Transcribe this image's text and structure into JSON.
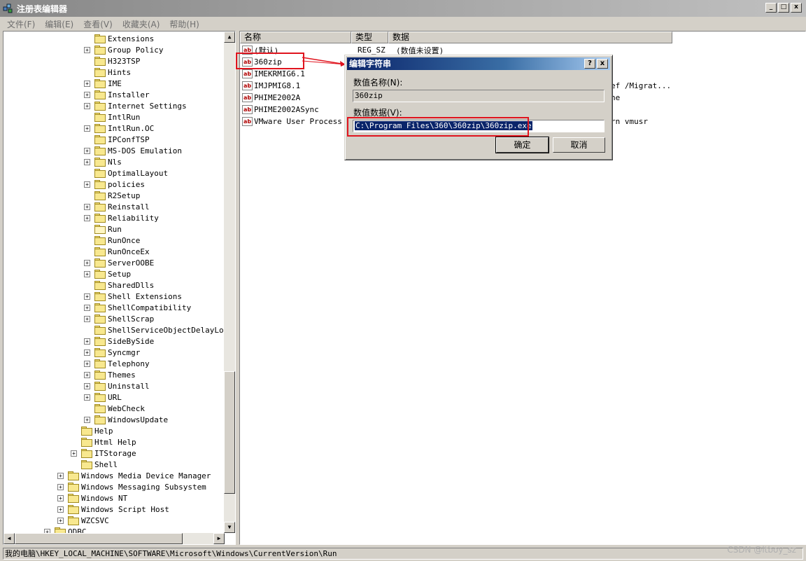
{
  "window": {
    "title": "注册表编辑器",
    "controls": [
      "_",
      "□",
      "x"
    ]
  },
  "menu": [
    "文件(F)",
    "编辑(E)",
    "查看(V)",
    "收藏夹(A)",
    "帮助(H)"
  ],
  "tree": {
    "items": [
      {
        "label": "Extensions",
        "level": 3,
        "expander": "none"
      },
      {
        "label": "Group Policy",
        "level": 3,
        "expander": "+"
      },
      {
        "label": "H323TSP",
        "level": 3,
        "expander": "none"
      },
      {
        "label": "Hints",
        "level": 3,
        "expander": "none"
      },
      {
        "label": "IME",
        "level": 3,
        "expander": "+"
      },
      {
        "label": "Installer",
        "level": 3,
        "expander": "+"
      },
      {
        "label": "Internet Settings",
        "level": 3,
        "expander": "+"
      },
      {
        "label": "IntlRun",
        "level": 3,
        "expander": "none"
      },
      {
        "label": "IntlRun.OC",
        "level": 3,
        "expander": "+"
      },
      {
        "label": "IPConfTSP",
        "level": 3,
        "expander": "none"
      },
      {
        "label": "MS-DOS Emulation",
        "level": 3,
        "expander": "+"
      },
      {
        "label": "Nls",
        "level": 3,
        "expander": "+"
      },
      {
        "label": "OptimalLayout",
        "level": 3,
        "expander": "none"
      },
      {
        "label": "policies",
        "level": 3,
        "expander": "+"
      },
      {
        "label": "R2Setup",
        "level": 3,
        "expander": "none"
      },
      {
        "label": "Reinstall",
        "level": 3,
        "expander": "+"
      },
      {
        "label": "Reliability",
        "level": 3,
        "expander": "+"
      },
      {
        "label": "Run",
        "level": 3,
        "expander": "none",
        "open": true
      },
      {
        "label": "RunOnce",
        "level": 3,
        "expander": "none"
      },
      {
        "label": "RunOnceEx",
        "level": 3,
        "expander": "none"
      },
      {
        "label": "ServerOOBE",
        "level": 3,
        "expander": "+"
      },
      {
        "label": "Setup",
        "level": 3,
        "expander": "+"
      },
      {
        "label": "SharedDlls",
        "level": 3,
        "expander": "none"
      },
      {
        "label": "Shell Extensions",
        "level": 3,
        "expander": "+"
      },
      {
        "label": "ShellCompatibility",
        "level": 3,
        "expander": "+"
      },
      {
        "label": "ShellScrap",
        "level": 3,
        "expander": "+"
      },
      {
        "label": "ShellServiceObjectDelayLoad",
        "level": 3,
        "expander": "none"
      },
      {
        "label": "SideBySide",
        "level": 3,
        "expander": "+"
      },
      {
        "label": "Syncmgr",
        "level": 3,
        "expander": "+"
      },
      {
        "label": "Telephony",
        "level": 3,
        "expander": "+"
      },
      {
        "label": "Themes",
        "level": 3,
        "expander": "+"
      },
      {
        "label": "Uninstall",
        "level": 3,
        "expander": "+"
      },
      {
        "label": "URL",
        "level": 3,
        "expander": "+"
      },
      {
        "label": "WebCheck",
        "level": 3,
        "expander": "none"
      },
      {
        "label": "WindowsUpdate",
        "level": 3,
        "expander": "+"
      },
      {
        "label": "Help",
        "level": 2,
        "expander": "none"
      },
      {
        "label": "Html Help",
        "level": 2,
        "expander": "none"
      },
      {
        "label": "ITStorage",
        "level": 2,
        "expander": "+"
      },
      {
        "label": "Shell",
        "level": 2,
        "expander": "none"
      },
      {
        "label": "Windows Media Device Manager",
        "level": 1,
        "expander": "+"
      },
      {
        "label": "Windows Messaging Subsystem",
        "level": 1,
        "expander": "+"
      },
      {
        "label": "Windows NT",
        "level": 1,
        "expander": "+"
      },
      {
        "label": "Windows Script Host",
        "level": 1,
        "expander": "+"
      },
      {
        "label": "WZCSVC",
        "level": 1,
        "expander": "+"
      },
      {
        "label": "ODBC",
        "level": 0,
        "expander": "+"
      }
    ]
  },
  "list": {
    "columns": [
      "名称",
      "类型",
      "数据"
    ],
    "rows": [
      {
        "name": "(默认)",
        "type": "REG_SZ",
        "data": "(数值未设置)"
      },
      {
        "name": "360zip",
        "type": "",
        "data": ""
      },
      {
        "name": "IMEKRMIG6.1",
        "type": "",
        "data": ""
      },
      {
        "name": "IMJPMIG8.1",
        "type": "",
        "data": ""
      },
      {
        "name": "PHIME2002A",
        "type": "",
        "data": ""
      },
      {
        "name": "PHIME2002ASync",
        "type": "",
        "data": ""
      },
      {
        "name": "VMware User Process",
        "type": "",
        "data": ""
      }
    ],
    "partial_texts": [
      "ef /Migrat...",
      "ne",
      "rn vmusr"
    ]
  },
  "dialog": {
    "title": "编辑字符串",
    "help_btn": "?",
    "close_btn": "x",
    "name_label": "数值名称(N):",
    "name_value": "360zip",
    "data_label": "数值数据(V):",
    "data_value": "C:\\Program Files\\360\\360zip\\360zip.exe",
    "ok": "确定",
    "cancel": "取消"
  },
  "status": "我的电脑\\HKEY_LOCAL_MACHINE\\SOFTWARE\\Microsoft\\Windows\\CurrentVersion\\Run",
  "watermark": "CSDN @ltboy_sz",
  "colors": {
    "highlight": "#e0141e",
    "selection": "#0a246a"
  }
}
